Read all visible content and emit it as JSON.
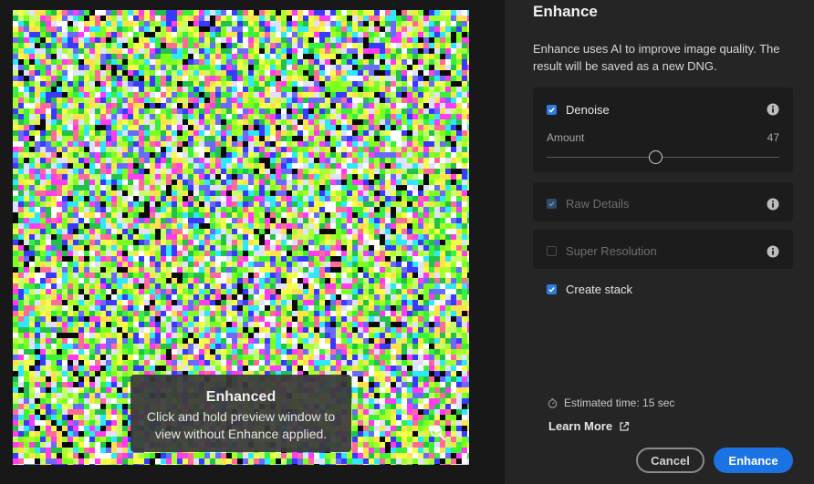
{
  "preview": {
    "tooltip_title": "Enhanced",
    "tooltip_body": "Click and hold preview window to view without Enhance applied.",
    "zoom_icon": "zoom-in-icon"
  },
  "panel": {
    "title": "Enhance",
    "description": "Enhance uses AI to improve image quality. The result will be saved as a new DNG.",
    "denoise": {
      "label": "Denoise",
      "checked": true,
      "amount_label": "Amount",
      "amount_value": "47",
      "amount_fraction": 0.47
    },
    "raw_details": {
      "label": "Raw Details",
      "checked": true,
      "disabled": true
    },
    "super_resolution": {
      "label": "Super Resolution",
      "checked": false,
      "disabled": true
    },
    "create_stack": {
      "label": "Create stack",
      "checked": true
    },
    "estimated_time": "Estimated time: 15 sec",
    "learn_more": "Learn More",
    "cancel_label": "Cancel",
    "enhance_label": "Enhance"
  },
  "colors": {
    "accent": "#1b73e3",
    "panel_bg": "#252525",
    "card_bg": "#1c1c1c"
  }
}
